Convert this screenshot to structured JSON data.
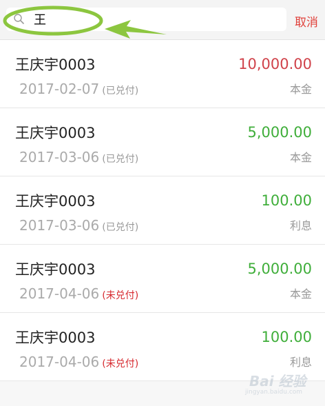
{
  "search": {
    "query": "王",
    "cancel_label": "取消"
  },
  "records": [
    {
      "name": "王庆宇0003",
      "date": "2017-02-07",
      "status": "(已兑付)",
      "status_type": "paid",
      "amount": "10,000.00",
      "amount_color": "red",
      "type": "本金"
    },
    {
      "name": "王庆宇0003",
      "date": "2017-03-06",
      "status": "(已兑付)",
      "status_type": "paid",
      "amount": "5,000.00",
      "amount_color": "green",
      "type": "本金"
    },
    {
      "name": "王庆宇0003",
      "date": "2017-03-06",
      "status": "(已兑付)",
      "status_type": "paid",
      "amount": "100.00",
      "amount_color": "green",
      "type": "利息"
    },
    {
      "name": "王庆宇0003",
      "date": "2017-04-06",
      "status": "(未兑付)",
      "status_type": "unpaid",
      "amount": "5,000.00",
      "amount_color": "green",
      "type": "本金"
    },
    {
      "name": "王庆宇0003",
      "date": "2017-04-06",
      "status": "(未兑付)",
      "status_type": "unpaid",
      "amount": "100.00",
      "amount_color": "green",
      "type": "利息"
    }
  ],
  "watermark": {
    "text": "Bai 经验",
    "sub": "jingyan.baidu.com"
  },
  "colors": {
    "cancel": "#e0403a",
    "amount_red": "#d0424a",
    "amount_green": "#3fae3a",
    "unpaid": "#d6282e",
    "annotation": "#8cc63f"
  }
}
